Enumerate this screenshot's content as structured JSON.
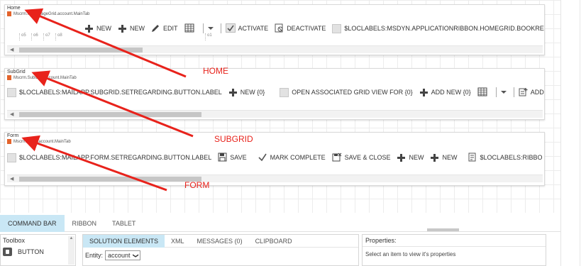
{
  "home": {
    "title": "Home",
    "subtitle": "Mscrm.HomepageGrid.account.MainTab",
    "ruler": [
      "o5",
      "o6",
      "o7",
      "o8"
    ],
    "ruler_end": "o1",
    "commands": [
      {
        "icon": "plus-icon",
        "label": "NEW"
      },
      {
        "icon": "plus-icon",
        "label": "NEW"
      },
      {
        "icon": "pencil-icon",
        "label": "EDIT"
      },
      {
        "icon": "grid-icon",
        "label": ""
      },
      {
        "icon": "chevron-down-icon",
        "label": ""
      },
      {
        "icon": "checkmark-icon",
        "label": "ACTIVATE"
      },
      {
        "icon": "deactivate-icon",
        "label": "DEACTIVATE"
      },
      {
        "icon": "checkbox-icon",
        "label": "$LOCLABELS:MSDYN.APPLICATIONRIBBON.HOMEGRID.BOOKRE"
      }
    ],
    "scroll_thumb_fraction": 0.23
  },
  "subgrid": {
    "title": "SubGrid",
    "subtitle": "Mscrm.SubGrid.account.MainTab",
    "commands": [
      {
        "icon": "checkbox-icon",
        "label": "$LOCLABELS:MAILAPP.SUBGRID.SETREGARDING.BUTTON.LABEL"
      },
      {
        "icon": "plus-icon",
        "label": "NEW {0}"
      },
      {
        "icon": "checkbox-icon",
        "label": "OPEN ASSOCIATED GRID VIEW FOR {0}"
      },
      {
        "icon": "plus-icon",
        "label": "ADD NEW {0}"
      },
      {
        "icon": "grid-icon",
        "label": ""
      },
      {
        "icon": "chevron-down-icon",
        "label": ""
      },
      {
        "icon": "add-existing-icon",
        "label": "ADD"
      }
    ],
    "scroll_thumb_fraction": 0.34
  },
  "form": {
    "title": "Form",
    "subtitle": "Mscrm.Form.account.MainTab",
    "commands": [
      {
        "icon": "checkbox-icon",
        "label": "$LOCLABELS:MAILAPP.FORM.SETREGARDING.BUTTON.LABEL"
      },
      {
        "icon": "save-icon",
        "label": "SAVE"
      },
      {
        "icon": "checkmark-icon",
        "label": "MARK COMPLETE"
      },
      {
        "icon": "save-close-icon",
        "label": "SAVE & CLOSE"
      },
      {
        "icon": "plus-icon",
        "label": "NEW"
      },
      {
        "icon": "plus-icon",
        "label": "NEW"
      },
      {
        "icon": "document-icon",
        "label": "$LOCLABELS:RIBBO"
      }
    ],
    "scroll_thumb_fraction": 0.34
  },
  "annotations": {
    "home": "HOME",
    "subgrid": "SUBGRID",
    "form": "FORM"
  },
  "bottom_tabs": [
    {
      "label": "COMMAND BAR",
      "active": true
    },
    {
      "label": "RIBBON",
      "active": false
    },
    {
      "label": "TABLET",
      "active": false
    }
  ],
  "toolbox": {
    "title": "Toolbox",
    "items": [
      {
        "label": "BUTTON"
      }
    ]
  },
  "solution": {
    "tabs": [
      {
        "label": "SOLUTION ELEMENTS",
        "active": true
      },
      {
        "label": "XML",
        "active": false
      },
      {
        "label": "MESSAGES (0)",
        "active": false
      },
      {
        "label": "CLIPBOARD",
        "active": false
      }
    ],
    "entity_label": "Entity:",
    "entity_value": "account"
  },
  "properties": {
    "title": "Properties:",
    "message": "Select an item to view it's properties"
  },
  "colors": {
    "accent_tab": "#c9e7f5",
    "annotation": "#e8221b",
    "orange_marker": "#e3632b"
  }
}
